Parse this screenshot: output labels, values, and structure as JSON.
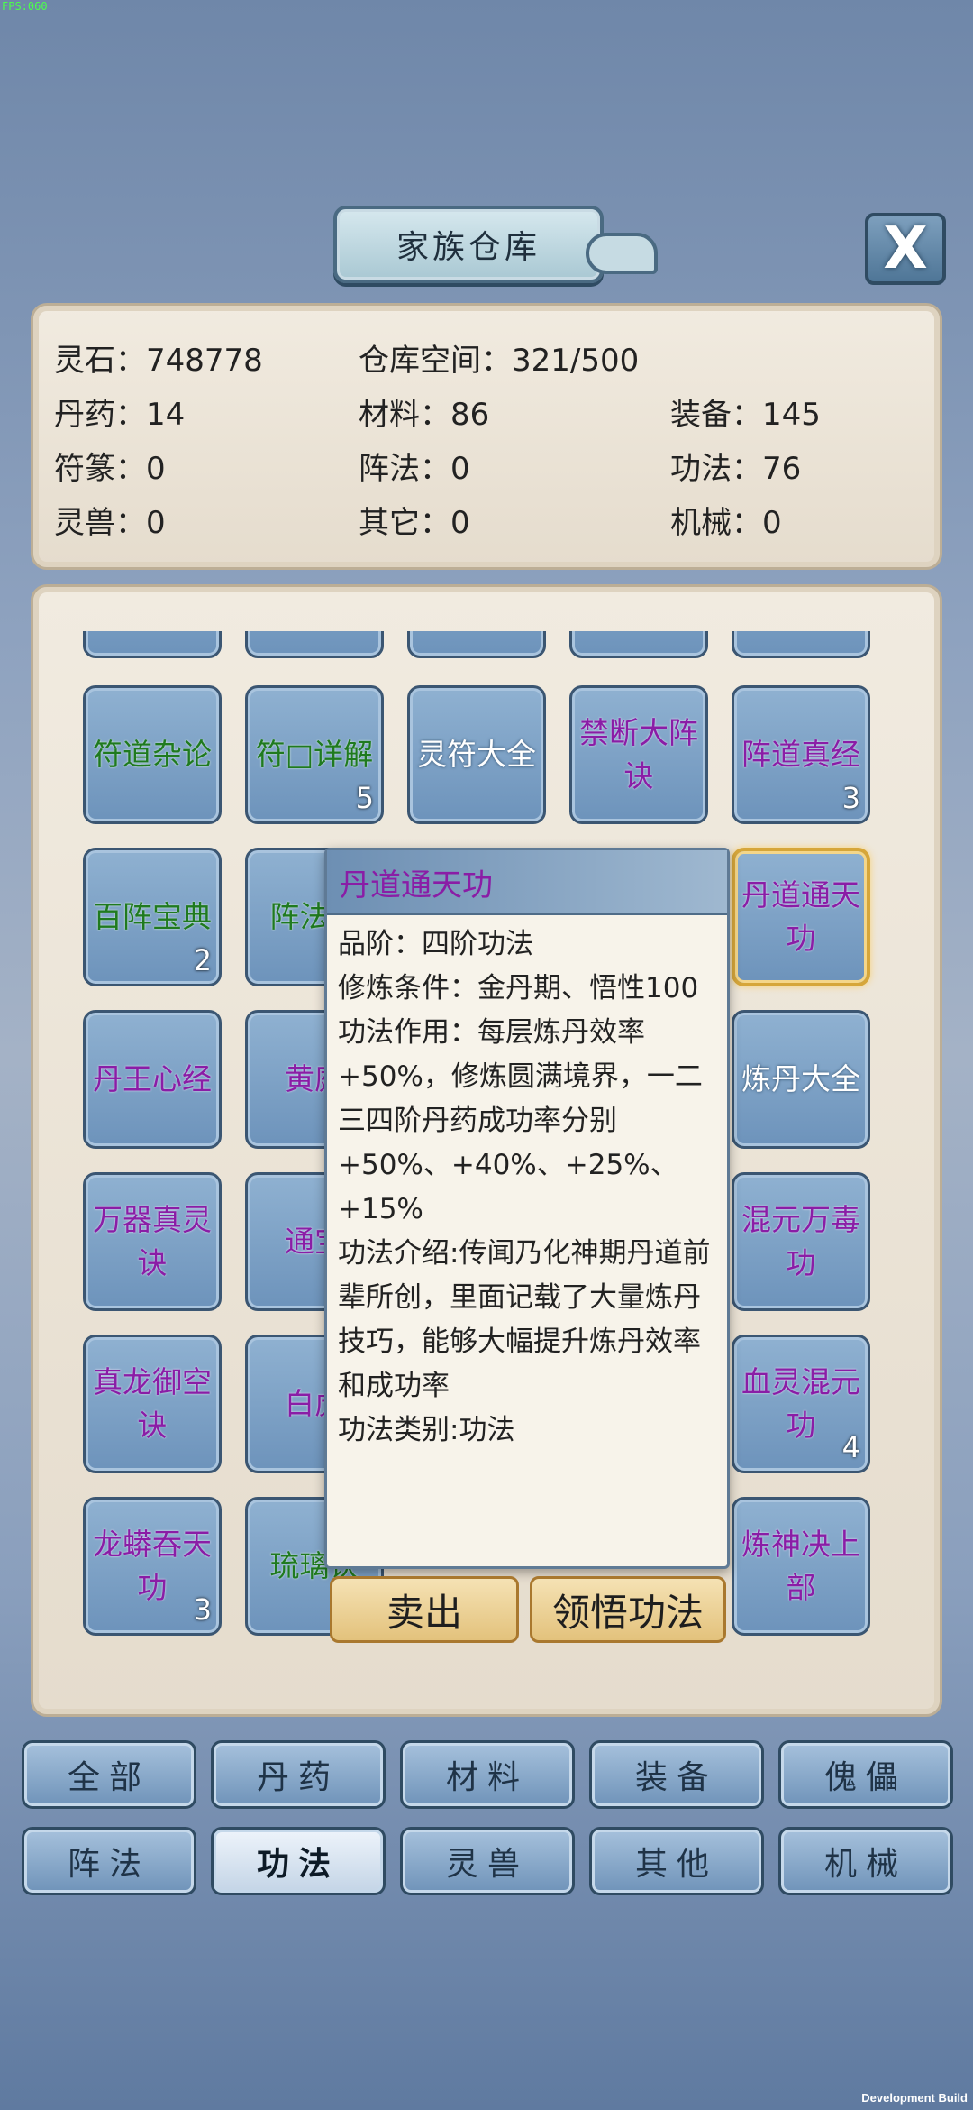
{
  "fps": "FPS:060",
  "dev_build": "Development Build",
  "title": "家族仓库",
  "close_label": "X",
  "stats": [
    {
      "label": "灵石：748778"
    },
    {
      "label": "仓库空间：321/500"
    },
    {
      "label": "丹药：14"
    },
    {
      "label": "材料：86"
    },
    {
      "label": "装备：145"
    },
    {
      "label": "符篆：0"
    },
    {
      "label": "阵法：0"
    },
    {
      "label": "功法：76"
    },
    {
      "label": "灵兽：0"
    },
    {
      "label": "其它：0"
    },
    {
      "label": "机械：0"
    }
  ],
  "items": [
    {
      "name": "符道杂论",
      "count": ""
    },
    {
      "name": "符□详解",
      "count": "5"
    },
    {
      "name": "灵符大全",
      "count": ""
    },
    {
      "name": "禁断大阵诀",
      "count": ""
    },
    {
      "name": "阵道真经",
      "count": "3"
    },
    {
      "name": "百阵宝典",
      "count": "2"
    },
    {
      "name": "阵法宝",
      "count": ""
    },
    {
      "name": "丹道通天功",
      "count": ""
    },
    {
      "name": "丹王心经",
      "count": ""
    },
    {
      "name": "黄庭",
      "count": ""
    },
    {
      "name": "炼丹大全",
      "count": ""
    },
    {
      "name": "万器真灵诀",
      "count": ""
    },
    {
      "name": "通宝",
      "count": ""
    },
    {
      "name": "混元万毒功",
      "count": ""
    },
    {
      "name": "真龙御空诀",
      "count": ""
    },
    {
      "name": "白虎",
      "count": ""
    },
    {
      "name": "血灵混元功",
      "count": "4"
    },
    {
      "name": "龙蟒吞天功",
      "count": "3"
    },
    {
      "name": "琉璃诀",
      "count": ""
    },
    {
      "name": "炼神决上部",
      "count": ""
    }
  ],
  "tooltip": {
    "title": "丹道通天功",
    "grade": "品阶：四阶功法",
    "requirement": "修炼条件：金丹期、悟性100",
    "effect": "功法作用：每层炼丹效率+50%，修炼圆满境界，一二三四阶丹药成功率分别+50%、+40%、+25%、+15%",
    "intro": "功法介绍:传闻乃化神期丹道前辈所创，里面记载了大量炼丹技巧，能够大幅提升炼丹效率和成功率",
    "category": "功法类别:功法",
    "sell_label": "卖出",
    "learn_label": "领悟功法"
  },
  "tabs": [
    {
      "label": "全部"
    },
    {
      "label": "丹药"
    },
    {
      "label": "材料"
    },
    {
      "label": "装备"
    },
    {
      "label": "傀儡"
    },
    {
      "label": "阵法"
    },
    {
      "label": "功法"
    },
    {
      "label": "灵兽"
    },
    {
      "label": "其他"
    },
    {
      "label": "机械"
    }
  ],
  "active_tab": "功法",
  "colors": {
    "green_item": "#1f7a1f",
    "purple_item": "#8a1da6",
    "selected_border": "#d6a63a"
  }
}
